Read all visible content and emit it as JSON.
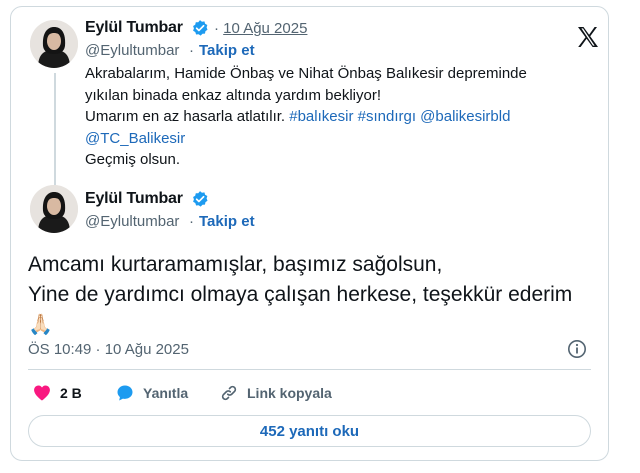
{
  "quoted_tweet": {
    "author_name": "Eylül Tumbar",
    "separator": "·",
    "date": "10 Ağu 2025",
    "handle": "@Eylultumbar",
    "handle_separator": "·",
    "follow_label": "Takip et",
    "lines": [
      "Akrabalarım, Hamide Önbaş ve Nihat Önbaş Balıkesir depreminde",
      "yıkılan binada enkaz altında yardım bekliyor!"
    ],
    "line3_text": "Umarım en az hasarla atlatılır.",
    "hashtags": [
      "#balıkesir",
      "#sındırgı",
      "@balikesirbld"
    ],
    "line4_mention": "@TC_Balikesir",
    "line5": "Geçmiş olsun."
  },
  "main_tweet": {
    "author_name": "Eylül Tumbar",
    "handle": "@Eylultumbar",
    "handle_separator": "·",
    "follow_label": "Takip et",
    "text_lines": [
      "Amcamı kurtaramamışlar, başımız sağolsun,",
      "Yine de yardımcı olmaya çalışan herkese, teşekkür ederim"
    ],
    "emoji": "🙏🏻",
    "timestamp": "ÖS 10:49 · 10 Ağu 2025"
  },
  "actions": {
    "like_count": "2 B",
    "reply_label": "Yanıtla",
    "copy_link_label": "Link kopyala"
  },
  "read_replies_label": "452 yanıtı oku",
  "icons": {
    "logo": "x-logo-icon",
    "verified": "verified-badge-icon",
    "info": "info-icon",
    "like": "heart-icon",
    "reply": "speech-bubble-icon",
    "link": "link-icon"
  },
  "colors": {
    "link_blue": "#1d69b9",
    "verified_blue": "#1d9bf0",
    "heart_red": "#f91880",
    "muted_text": "#536471",
    "border": "#cfd9de"
  }
}
